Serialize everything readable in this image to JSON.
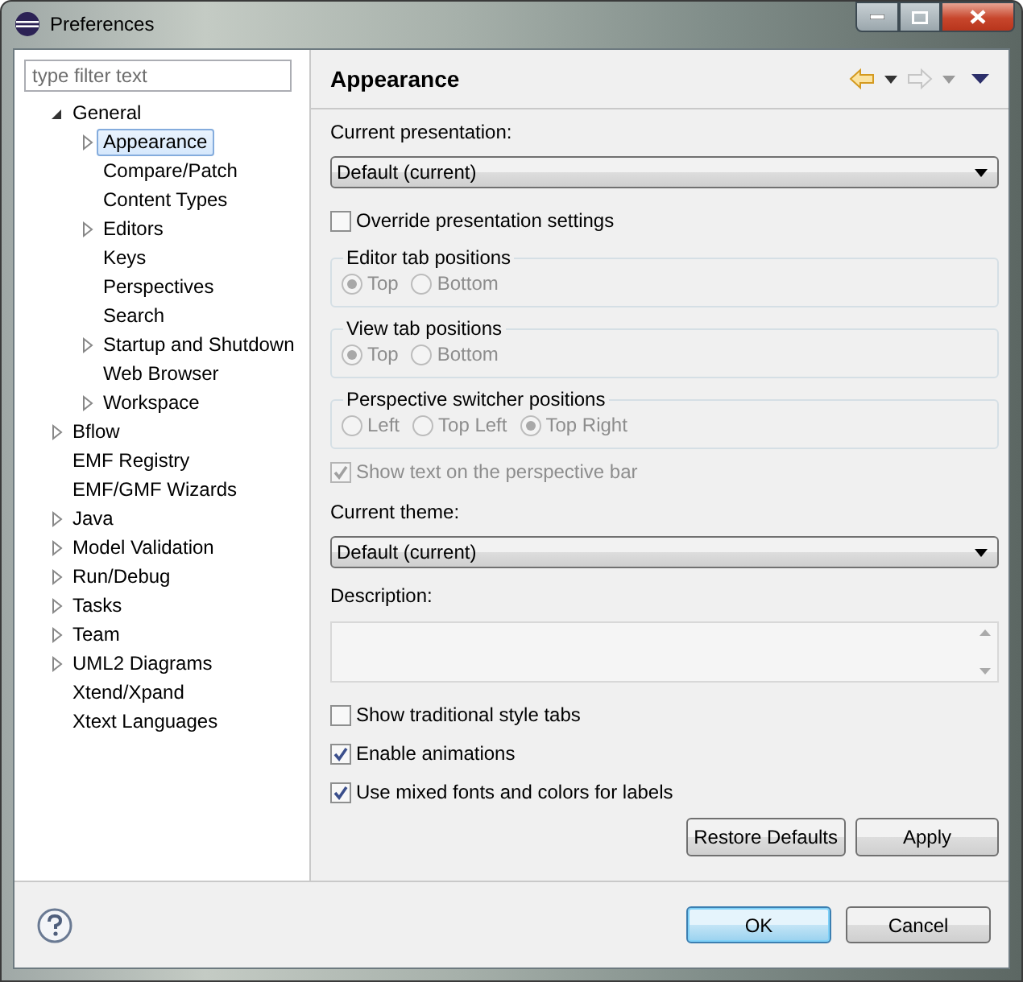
{
  "window": {
    "title": "Preferences"
  },
  "filter": {
    "placeholder": "type filter text"
  },
  "tree": [
    {
      "label": "General",
      "kind": "branch",
      "expanded": true,
      "selected": false,
      "children": [
        {
          "label": "Appearance",
          "kind": "branch",
          "expanded": false,
          "selected": true
        },
        {
          "label": "Compare/Patch",
          "kind": "leaf",
          "selected": false
        },
        {
          "label": "Content Types",
          "kind": "leaf",
          "selected": false
        },
        {
          "label": "Editors",
          "kind": "branch",
          "expanded": false,
          "selected": false
        },
        {
          "label": "Keys",
          "kind": "leaf",
          "selected": false
        },
        {
          "label": "Perspectives",
          "kind": "leaf",
          "selected": false
        },
        {
          "label": "Search",
          "kind": "leaf",
          "selected": false
        },
        {
          "label": "Startup and Shutdown",
          "kind": "branch",
          "expanded": false,
          "selected": false
        },
        {
          "label": "Web Browser",
          "kind": "leaf",
          "selected": false
        },
        {
          "label": "Workspace",
          "kind": "branch",
          "expanded": false,
          "selected": false
        }
      ]
    },
    {
      "label": "Bflow",
      "kind": "branch",
      "expanded": false,
      "selected": false
    },
    {
      "label": "EMF Registry",
      "kind": "leaf",
      "selected": false
    },
    {
      "label": "EMF/GMF Wizards",
      "kind": "leaf",
      "selected": false
    },
    {
      "label": "Java",
      "kind": "branch",
      "expanded": false,
      "selected": false
    },
    {
      "label": "Model Validation",
      "kind": "branch",
      "expanded": false,
      "selected": false
    },
    {
      "label": "Run/Debug",
      "kind": "branch",
      "expanded": false,
      "selected": false
    },
    {
      "label": "Tasks",
      "kind": "branch",
      "expanded": false,
      "selected": false
    },
    {
      "label": "Team",
      "kind": "branch",
      "expanded": false,
      "selected": false
    },
    {
      "label": "UML2 Diagrams",
      "kind": "branch",
      "expanded": false,
      "selected": false
    },
    {
      "label": "Xtend/Xpand",
      "kind": "leaf",
      "selected": false
    },
    {
      "label": "Xtext Languages",
      "kind": "leaf",
      "selected": false
    }
  ],
  "page": {
    "title": "Appearance",
    "navigation": {
      "back_enabled": true,
      "forward_enabled": false
    },
    "presentation": {
      "label": "Current presentation:",
      "value": "Default (current)"
    },
    "override": {
      "label": "Override presentation settings",
      "checked": false,
      "disabled": false
    },
    "radio_groups": [
      {
        "title": "Editor tab positions",
        "disabled": true,
        "options": [
          {
            "label": "Top",
            "selected": true
          },
          {
            "label": "Bottom",
            "selected": false
          }
        ]
      },
      {
        "title": "View tab positions",
        "disabled": true,
        "options": [
          {
            "label": "Top",
            "selected": true
          },
          {
            "label": "Bottom",
            "selected": false
          }
        ]
      },
      {
        "title": "Perspective switcher positions",
        "disabled": true,
        "options": [
          {
            "label": "Left",
            "selected": false
          },
          {
            "label": "Top Left",
            "selected": false
          },
          {
            "label": "Top Right",
            "selected": true
          }
        ]
      }
    ],
    "show_text": {
      "label": "Show text on the perspective bar",
      "checked": true,
      "disabled": true
    },
    "theme": {
      "label": "Current theme:",
      "value": "Default (current)"
    },
    "description": {
      "label": "Description:"
    },
    "checkboxes": [
      {
        "label": "Show traditional style tabs",
        "checked": false,
        "disabled": false
      },
      {
        "label": "Enable animations",
        "checked": true,
        "disabled": false
      },
      {
        "label": "Use mixed fonts and colors for labels",
        "checked": true,
        "disabled": false
      }
    ],
    "buttons": [
      "Restore Defaults",
      "Apply"
    ]
  },
  "dialog_buttons": [
    {
      "label": "OK",
      "default": true
    },
    {
      "label": "Cancel",
      "default": false
    }
  ]
}
